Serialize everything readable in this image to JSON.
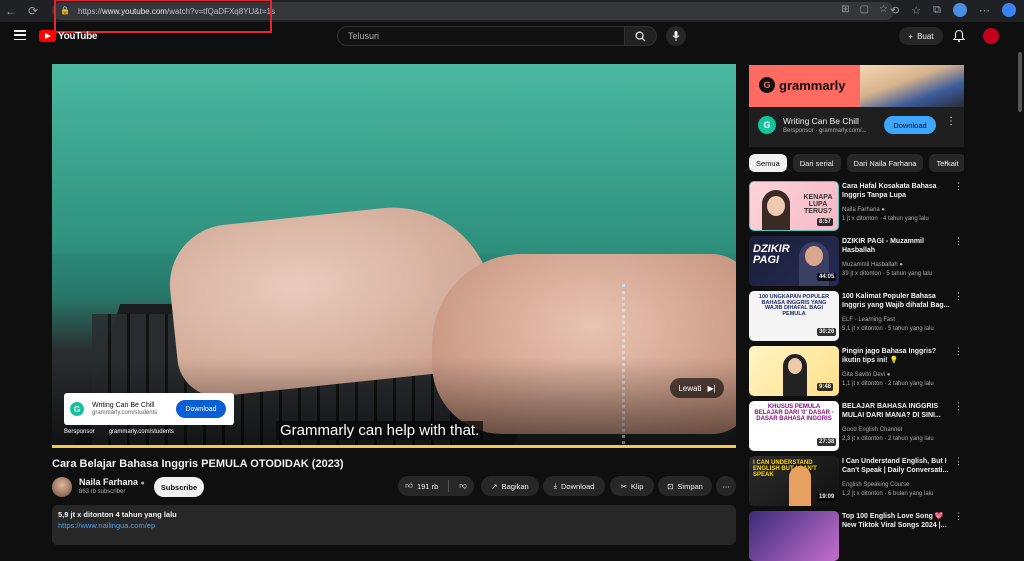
{
  "browser": {
    "url_prefix": "https://",
    "url_host": "www.youtube.com",
    "url_path": "/watch?v=tfQaDFXq8YU&t=1s"
  },
  "header": {
    "logo": "YouTube",
    "search_placeholder": "Telusuri",
    "create_label": "Buat"
  },
  "player": {
    "ad_title": "Writing Can Be Chill",
    "ad_url": "grammarly.com/students",
    "ad_download": "Download",
    "sponsor_label": "Bersponsor",
    "sponsor_site": "grammarly.com/students",
    "caption": "Grammarly can help with that.",
    "skip_label": "Lewati"
  },
  "video": {
    "title": "Cara Belajar Bahasa Inggris PEMULA OTODIDAK (2023)",
    "channel": "Naila Farhana",
    "subscribers": "863 rb subscriber",
    "subscribe": "Subscribe",
    "likes": "191 rb",
    "share": "Bagikan",
    "download": "Download",
    "clip": "Klip",
    "save": "Simpan",
    "views_meta": "5,9 jt x ditonton  4 tahun yang lalu",
    "desc_link": "https://www.nailingua.com/ep"
  },
  "sidebar_ad": {
    "brand": "grammarly",
    "title": "Writing Can Be Chill",
    "sponsor_line": "Bersponsor · grammarly.com/...",
    "download": "Download"
  },
  "chips": [
    "Semua",
    "Dari serial",
    "Dari Naila Farhana",
    "Terkait"
  ],
  "recommendations": [
    {
      "title": "Cara Hafal Kosakata Bahasa Inggris Tanpa Lupa",
      "channel": "Naila Farhana",
      "stats": "1 jt x ditonton · 4 tahun yang lalu",
      "duration": "8:57",
      "thumb_text": "KENAPA LUPA TERUS?"
    },
    {
      "title": "DZIKIR PAGI - Muzammil Hasballah",
      "channel": "Muzammil Hasballah",
      "stats": "39 jt x ditonton · 5 tahun yang lalu",
      "duration": "44:05",
      "thumb_text": "DZIKIR PAGI"
    },
    {
      "title": "100 Kalimat Populer Bahasa Inggris yang Wajib dihafal Bag...",
      "channel": "ELF - Learning Fast",
      "stats": "5,1 jt x ditonton · 5 tahun yang lalu",
      "duration": "30:26",
      "thumb_text": "100 UNGKAPAN POPULER BAHASA INGGRIS YANG WAJIB DIHAFAL BAGI PEMULA"
    },
    {
      "title": "Pingin jago Bahasa Inggris? ikutin tips ini! 💡",
      "channel": "Gita Savitri Devi",
      "stats": "1,1 jt x ditonton · 2 tahun yang lalu",
      "duration": "9:48",
      "thumb_text": ""
    },
    {
      "title": "BELAJAR BAHASA INGGRIS MULAI DARI MANA? DI SINI...",
      "channel": "Good English Channel",
      "stats": "2,3 jt x ditonton · 2 tahun yang lalu",
      "duration": "27:38",
      "thumb_text": "KHUSUS PEMULA BELAJAR DARI '0' DASAR - DASAR BAHASA INGGRIS"
    },
    {
      "title": "I Can Understand English, But I Can't Speak | Daily Conversati...",
      "channel": "English Speaking Course",
      "stats": "1,2 jt x ditonton · 6 bulan yang lalu",
      "duration": "19:09",
      "thumb_text": "I CAN UNDERSTAND ENGLISH BUT I CAN'T SPEAK"
    },
    {
      "title": "Top 100 English Love Song 💖 New Tiktok Viral Songs 2024 |...",
      "channel": "",
      "stats": "",
      "duration": "",
      "thumb_text": ""
    }
  ]
}
